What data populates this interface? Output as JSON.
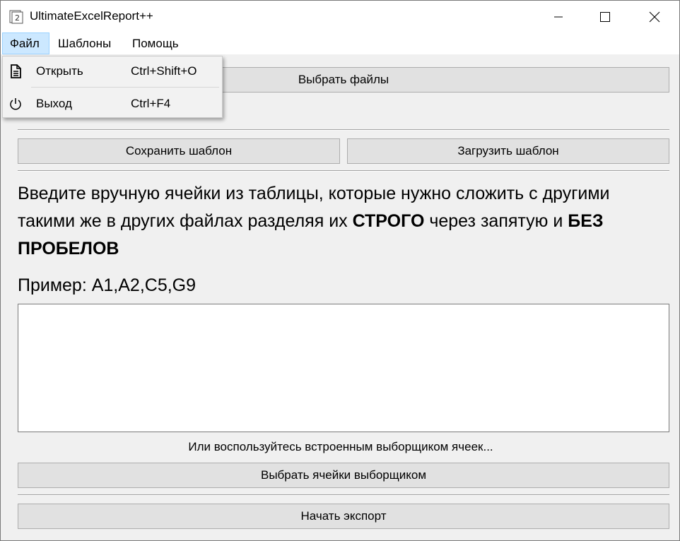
{
  "window": {
    "title": "UltimateExcelReport++"
  },
  "menubar": {
    "file": "Файл",
    "templates": "Шаблоны",
    "help": "Помощь"
  },
  "file_menu": {
    "open": {
      "label": "Открыть",
      "shortcut": "Ctrl+Shift+O",
      "icon": "document-icon"
    },
    "exit": {
      "label": "Выход",
      "shortcut": "Ctrl+F4",
      "icon": "power-icon"
    }
  },
  "main": {
    "select_files_label": "Выбрать файлы",
    "save_template_label": "Сохранить шаблон",
    "load_template_label": "Загрузить шаблон",
    "instructions": {
      "part1": "Введите вручную ячейки из таблицы, которые нужно сложить с другими такими же в других файлах разделяя их ",
      "bold1": "СТРОГО",
      "part2": " через запятую и ",
      "bold2": "БЕЗ ПРОБЕЛОВ"
    },
    "example": "Пример: A1,A2,C5,G9",
    "cells_input_value": "",
    "picker_hint": "Или воспользуйтесь встроенным выборщиком ячеек...",
    "picker_button_label": "Выбрать ячейки выборщиком",
    "export_button_label": "Начать экспорт"
  }
}
